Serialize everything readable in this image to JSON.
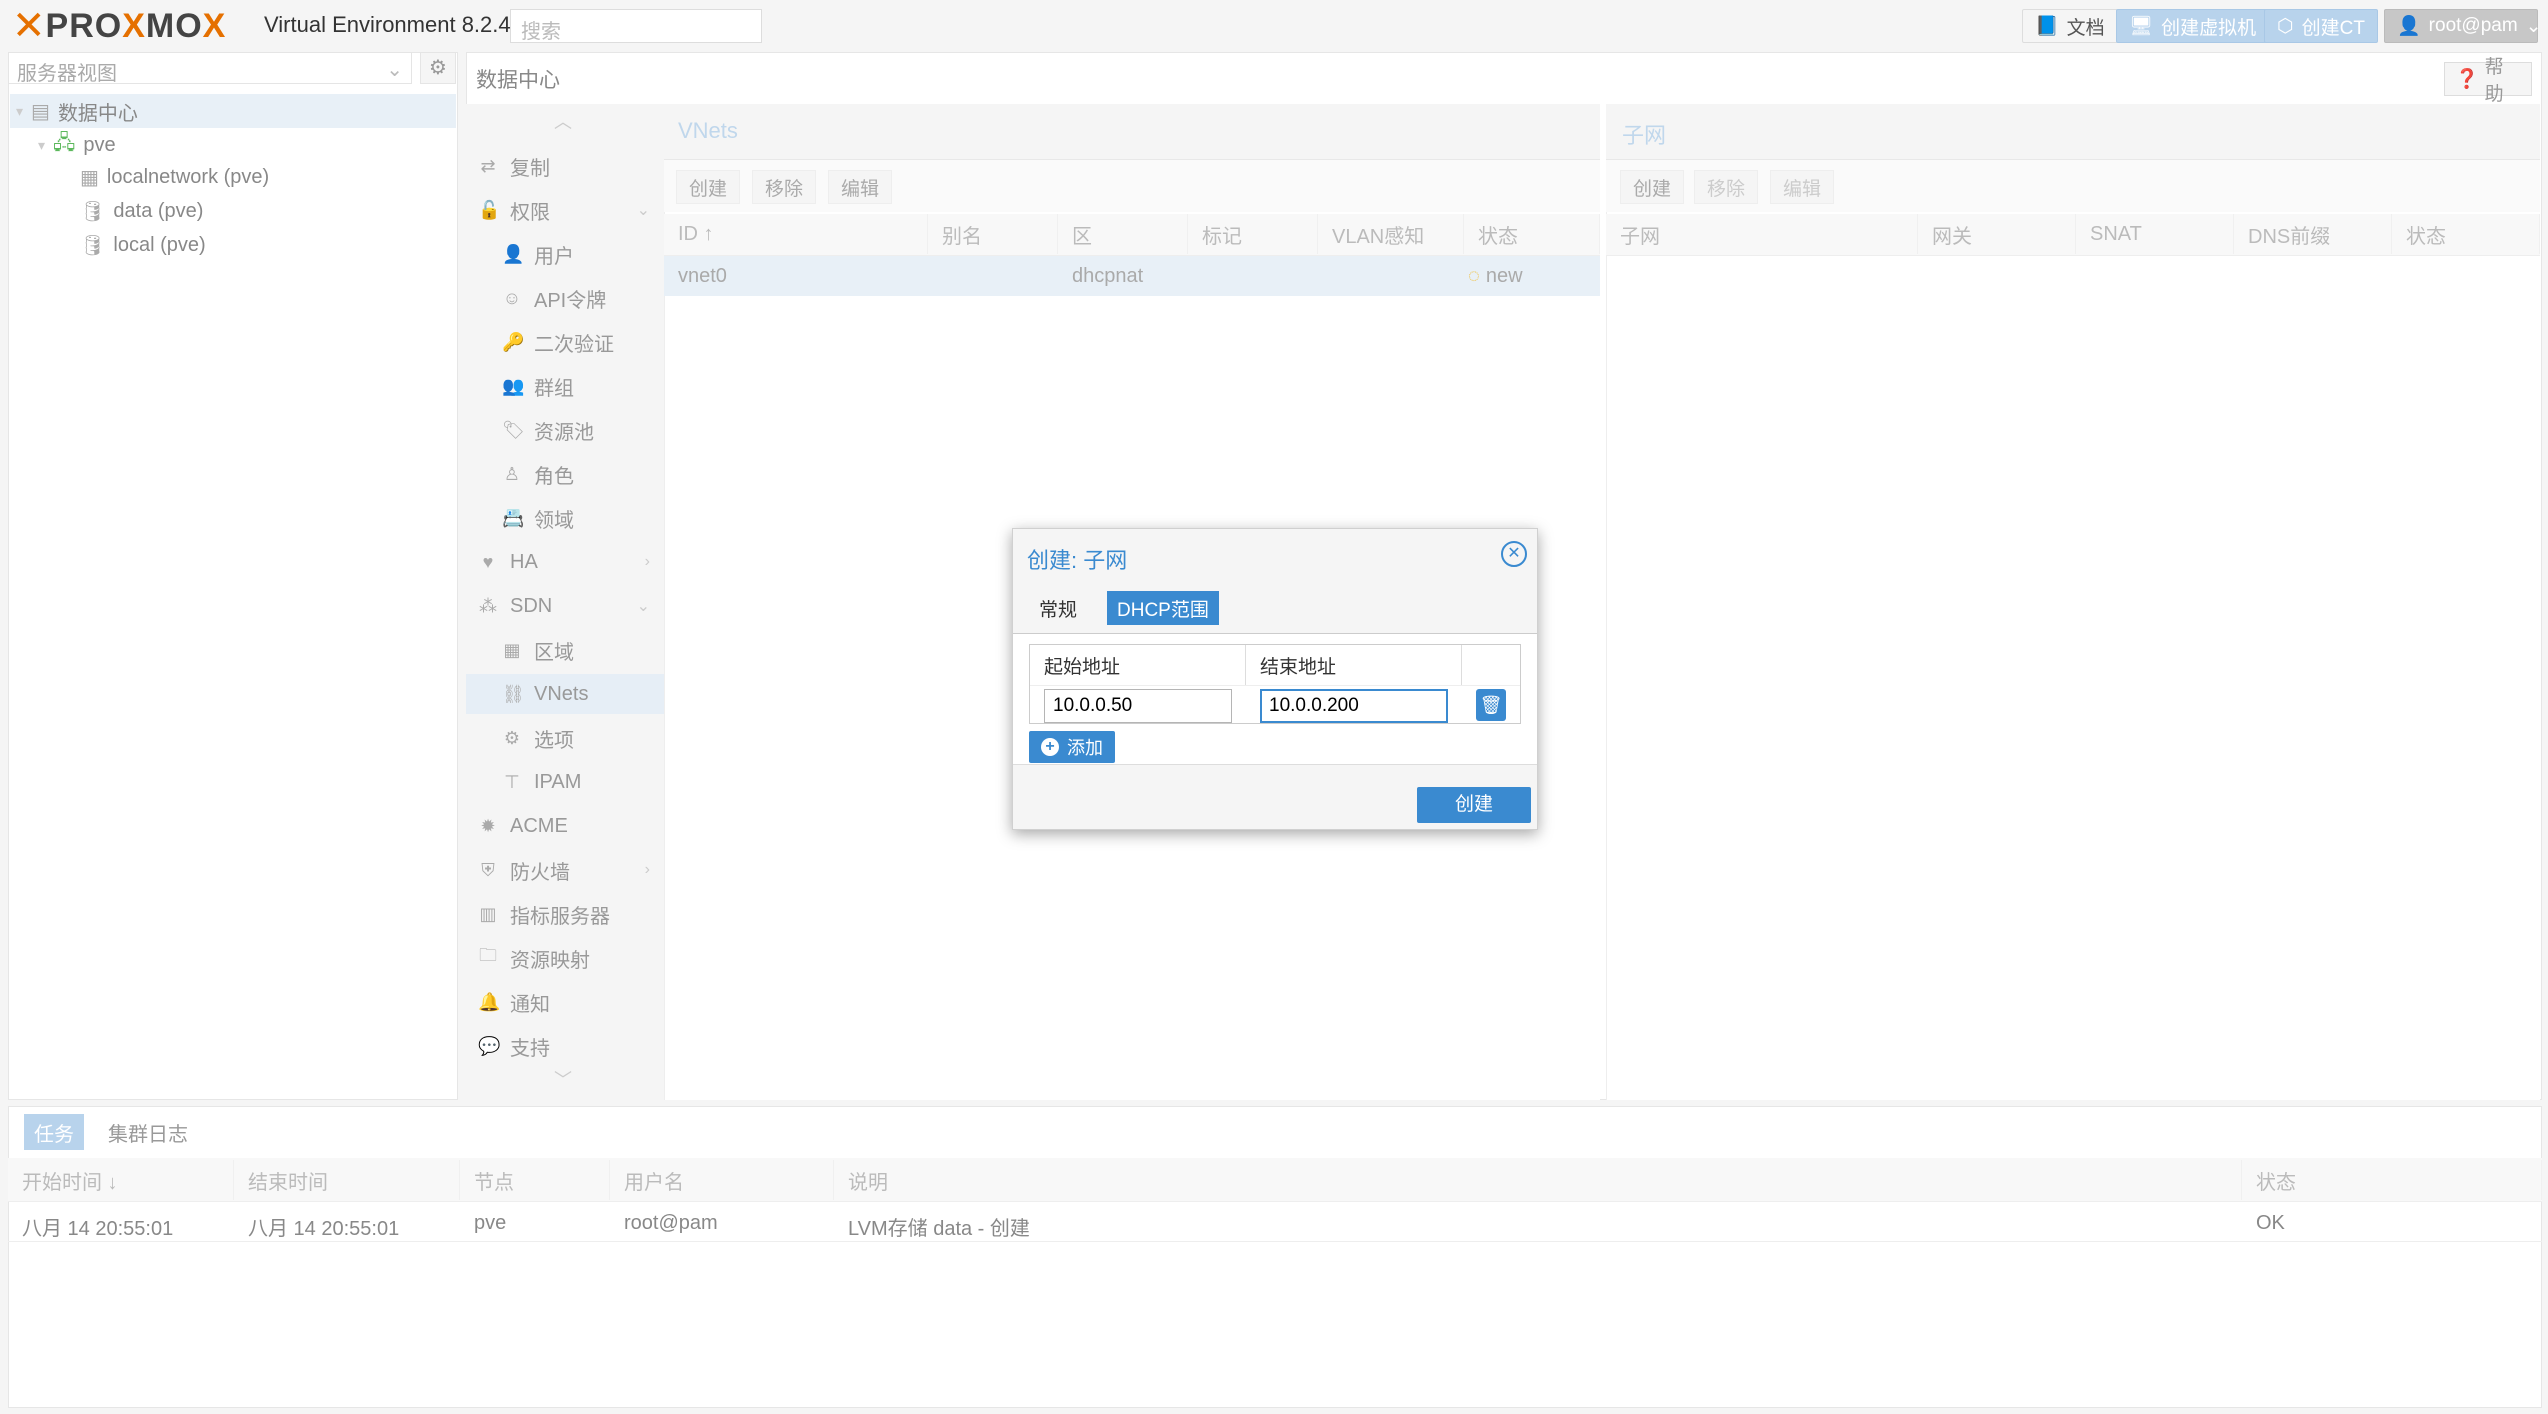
{
  "topbar": {
    "logo_brand": "PROXMOX",
    "version": "Virtual Environment 8.2.4",
    "search_placeholder": "搜索",
    "docs_label": "文档",
    "create_vm_label": "创建虚拟机",
    "create_ct_label": "创建CT",
    "user_label": "root@pam"
  },
  "left": {
    "view_select": "服务器视图",
    "tree": {
      "datacenter": "数据中心",
      "node": "pve",
      "items": [
        "localnetwork (pve)",
        "data (pve)",
        "local (pve)"
      ]
    }
  },
  "main": {
    "breadcrumb": "数据中心",
    "help_label": "帮助",
    "nav": {
      "items": [
        {
          "label": "复制",
          "icon": "retweet-icon"
        },
        {
          "label": "权限",
          "icon": "unlock-icon"
        },
        {
          "label": "用户",
          "icon": "user-icon"
        },
        {
          "label": "API令牌",
          "icon": "user-outline-icon"
        },
        {
          "label": "二次验证",
          "icon": "key-icon"
        },
        {
          "label": "群组",
          "icon": "users-icon"
        },
        {
          "label": "资源池",
          "icon": "tags-icon"
        },
        {
          "label": "角色",
          "icon": "male-icon"
        },
        {
          "label": "领域",
          "icon": "address-book-icon"
        },
        {
          "label": "HA",
          "icon": "heartbeat-icon"
        },
        {
          "label": "SDN",
          "icon": "sdn-icon"
        },
        {
          "label": "区域",
          "icon": "th-icon"
        },
        {
          "label": "VNets",
          "icon": "network-icon"
        },
        {
          "label": "选项",
          "icon": "gear-icon"
        },
        {
          "label": "IPAM",
          "icon": "signpost-icon"
        },
        {
          "label": "ACME",
          "icon": "certificate-icon"
        },
        {
          "label": "防火墙",
          "icon": "shield-icon"
        },
        {
          "label": "指标服务器",
          "icon": "bar-chart-icon"
        },
        {
          "label": "资源映射",
          "icon": "folder-icon"
        },
        {
          "label": "通知",
          "icon": "bell-icon"
        },
        {
          "label": "支持",
          "icon": "comments-icon"
        }
      ]
    },
    "vnets": {
      "title": "VNets",
      "toolbar": {
        "create": "创建",
        "remove": "移除",
        "edit": "编辑"
      },
      "columns": [
        "ID ↑",
        "别名",
        "区",
        "标记",
        "VLAN感知",
        "状态"
      ],
      "rows": [
        {
          "id": "vnet0",
          "alias": "",
          "zone": "dhcpnat",
          "tag": "",
          "vlan": "",
          "status": "new"
        }
      ]
    },
    "subnets": {
      "title": "子网",
      "toolbar": {
        "create": "创建",
        "remove": "移除",
        "edit": "编辑"
      },
      "columns": [
        "子网",
        "网关",
        "SNAT",
        "DNS前缀",
        "状态"
      ]
    }
  },
  "tasks": {
    "tabs": [
      "任务",
      "集群日志"
    ],
    "columns": [
      "开始时间 ↓",
      "结束时间",
      "节点",
      "用户名",
      "说明",
      "状态"
    ],
    "rows": [
      {
        "start": "八月 14 20:55:01",
        "end": "八月 14 20:55:01",
        "node": "pve",
        "user": "root@pam",
        "desc": "LVM存储 data - 创建",
        "status": "OK"
      }
    ]
  },
  "dialog": {
    "title": "创建: 子网",
    "tab_general": "常规",
    "tab_dhcp": "DHCP范围",
    "col_start": "起始地址",
    "col_end": "结束地址",
    "start_value": "10.0.0.50",
    "end_value": "10.0.0.200",
    "add_label": "添加",
    "create_label": "创建"
  },
  "colors": {
    "accent": "#3a8ad0",
    "brand_orange": "#e57000",
    "status_new": "#f0b400"
  }
}
